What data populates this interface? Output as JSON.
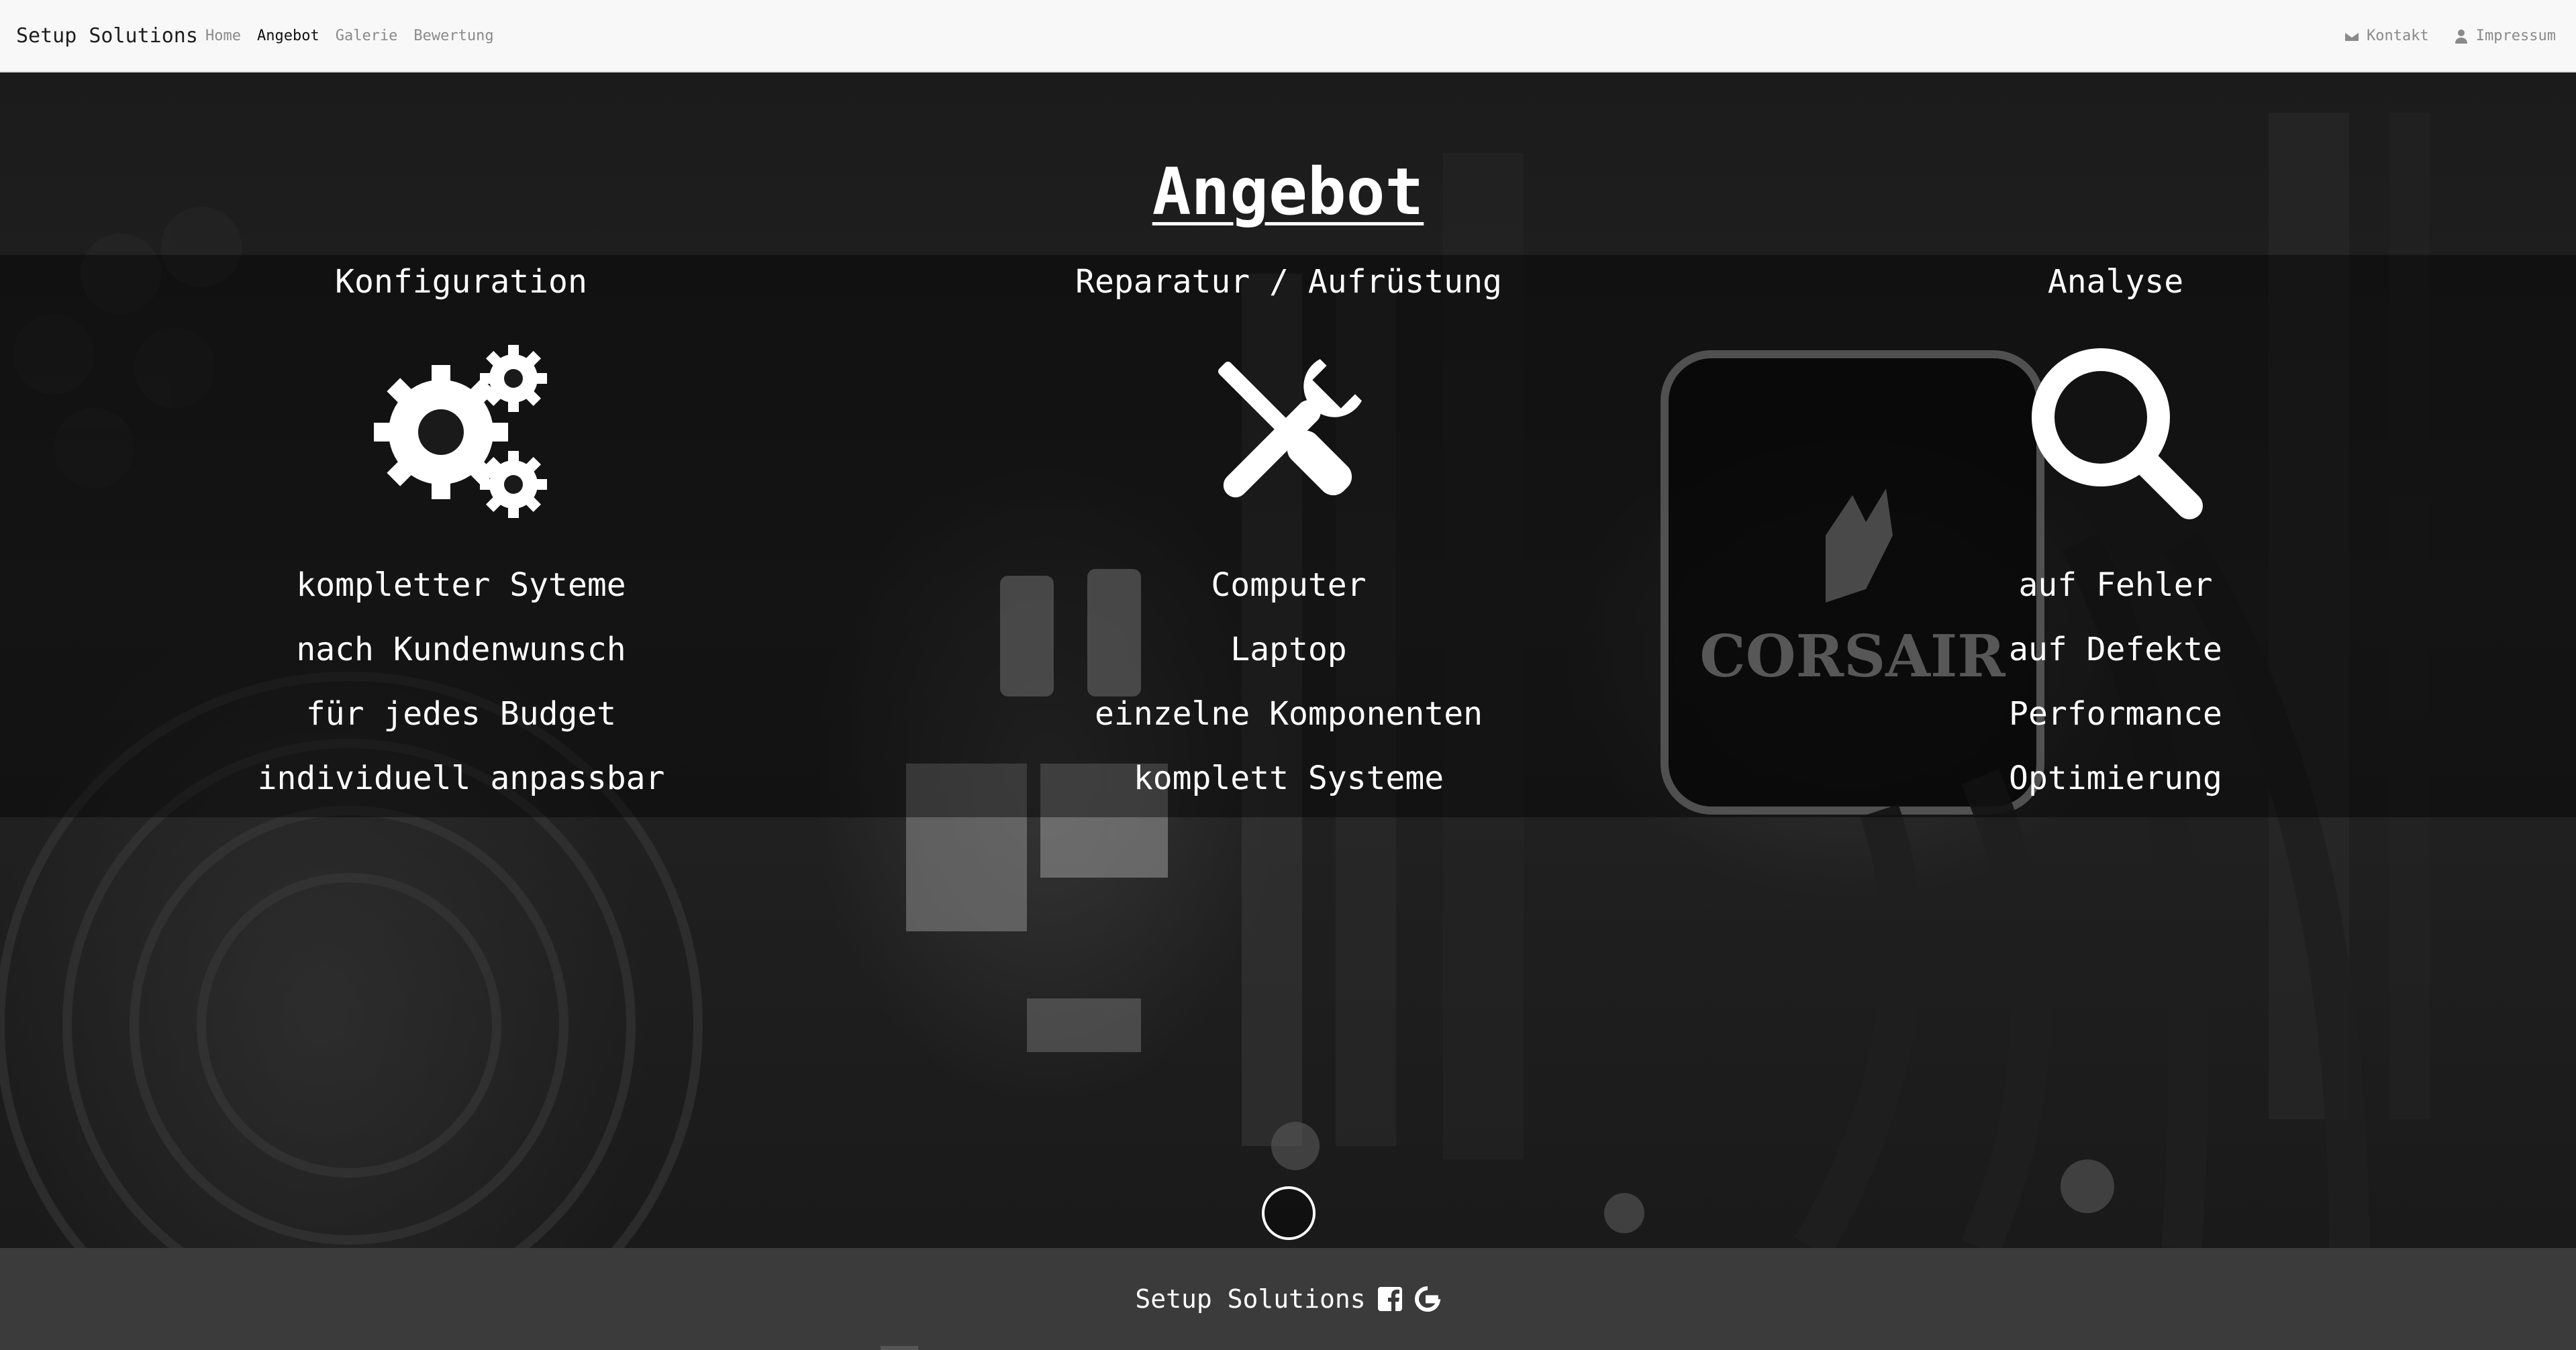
{
  "navbar": {
    "brand": "Setup Solutions",
    "links": [
      "Home",
      "Angebot",
      "Galerie",
      "Bewertung"
    ],
    "active": "Angebot",
    "right_links": [
      {
        "label": "Kontakt",
        "icon": "envelope-icon"
      },
      {
        "label": "Impressum",
        "icon": "user-icon"
      }
    ]
  },
  "main": {
    "title": "Angebot",
    "columns": [
      {
        "heading": "Konfiguration",
        "icon": "gears-icon",
        "items": [
          "kompletter Syteme",
          "nach Kundenwunsch",
          "für jedes Budget",
          "individuell anpassbar"
        ]
      },
      {
        "heading": "Reparatur / Aufrüstung",
        "icon": "tools-icon",
        "items": [
          "Computer",
          "Laptop",
          "einzelne Komponenten",
          "komplett Systeme"
        ]
      },
      {
        "heading": "Analyse",
        "icon": "search-icon",
        "items": [
          "auf Fehler",
          "auf Defekte",
          "Performance",
          "Optimierung"
        ]
      }
    ],
    "background_logo": "CORSAIR",
    "scroll_button_icon": "circle-icon"
  },
  "footer": {
    "brand": "Setup Solutions",
    "icons": [
      "facebook-icon",
      "google-icon"
    ]
  },
  "colors": {
    "navbar_bg": "#f8f8f9",
    "footer_bg": "#3b3b3b",
    "text_light": "#ffffff"
  }
}
